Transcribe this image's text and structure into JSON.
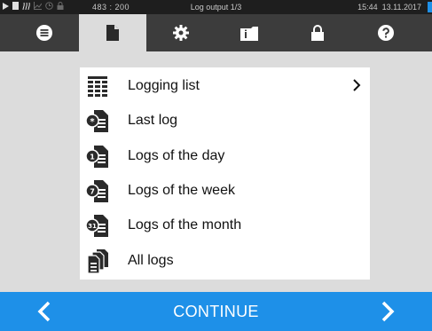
{
  "status_bar": {
    "icons": [
      "play-icon",
      "document-icon",
      "heat-icon",
      "graph-icon",
      "clock-icon",
      "lock-icon"
    ],
    "coordinate_readout": "483 : 200",
    "title": "Log output 1/3",
    "time": "15:44",
    "date": "13.11.2017"
  },
  "tabs": [
    {
      "icon": "list-icon",
      "active": false
    },
    {
      "icon": "document-icon",
      "active": true
    },
    {
      "icon": "gear-icon",
      "active": false
    },
    {
      "icon": "info-folder-icon",
      "active": false
    },
    {
      "icon": "lock-icon",
      "active": false
    },
    {
      "icon": "help-icon",
      "active": false
    }
  ],
  "menu": {
    "items": [
      {
        "label": "Logging list",
        "icon": "table-list-icon",
        "has_arrow": true
      },
      {
        "label": "Last log",
        "icon": "last-log-icon"
      },
      {
        "label": "Logs of the day",
        "icon": "day-log-icon",
        "badge": "1"
      },
      {
        "label": "Logs of the week",
        "icon": "week-log-icon",
        "badge": "7"
      },
      {
        "label": "Logs of the month",
        "icon": "month-log-icon",
        "badge": "31"
      },
      {
        "label": "All logs",
        "icon": "all-logs-icon"
      }
    ]
  },
  "bottom_bar": {
    "continue_label": "CONTINUE"
  },
  "colors": {
    "accent": "#1e90e8",
    "tabbar": "#3c3c3c",
    "background": "#dcdcdc"
  }
}
